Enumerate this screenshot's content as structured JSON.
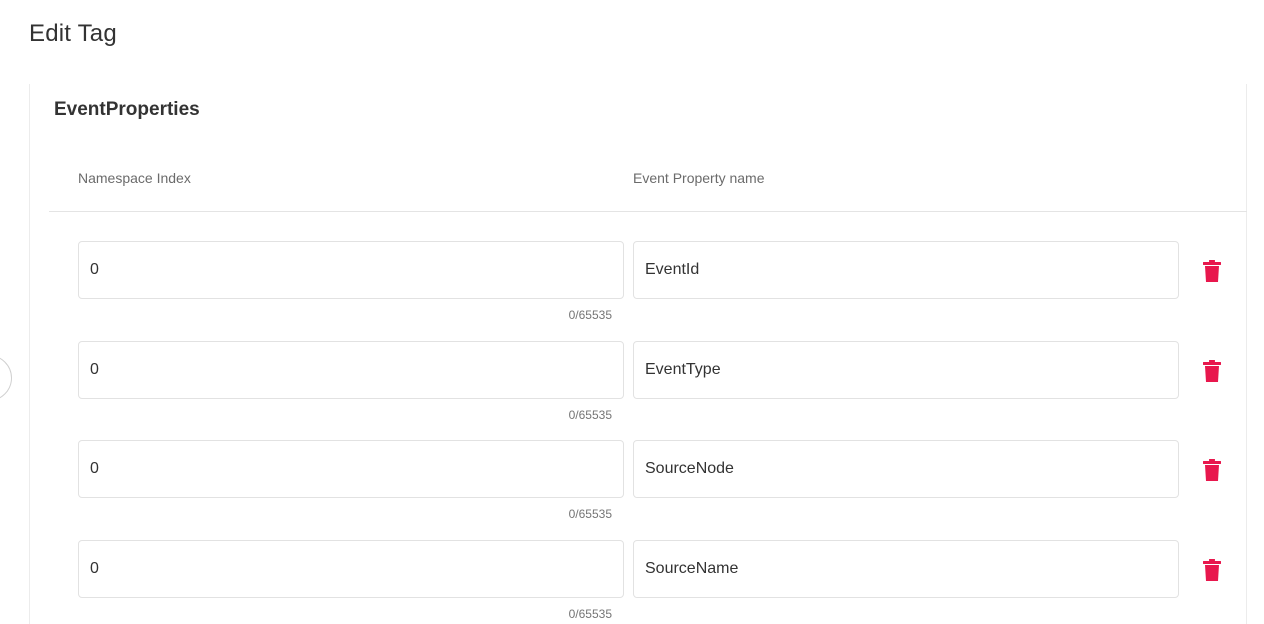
{
  "page": {
    "title": "Edit Tag"
  },
  "section": {
    "title": "EventProperties",
    "columns": {
      "namespace_index": "Namespace Index",
      "event_property_name": "Event Property name"
    }
  },
  "rows": [
    {
      "namespace_index": "0",
      "counter": "0/65535",
      "event_property_name": "EventId"
    },
    {
      "namespace_index": "0",
      "counter": "0/65535",
      "event_property_name": "EventType"
    },
    {
      "namespace_index": "0",
      "counter": "0/65535",
      "event_property_name": "SourceNode"
    },
    {
      "namespace_index": "0",
      "counter": "0/65535",
      "event_property_name": "SourceName"
    }
  ],
  "icons": {
    "delete": "trash-icon"
  },
  "colors": {
    "delete_icon": "#e8174d",
    "text": "#333333",
    "border": "#e2e2e2"
  }
}
